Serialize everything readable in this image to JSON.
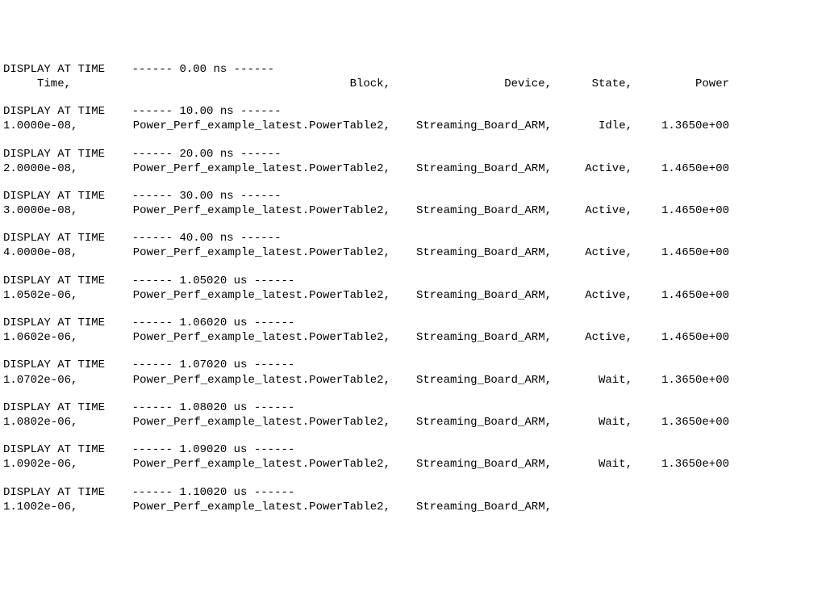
{
  "display_prefix": "DISPLAY AT TIME",
  "entries": [
    {
      "timestamp_header": "    ------ 0.00 ns ------",
      "time": "     Time,",
      "block": "Block,",
      "device": "Device,",
      "state": "State,",
      "power": "Power"
    },
    {
      "timestamp_header": "    ------ 10.00 ns ------",
      "time": "1.0000e-08,",
      "block": "Power_Perf_example_latest.PowerTable2,",
      "device": "Streaming_Board_ARM,",
      "state": "Idle,",
      "power": "1.3650e+00"
    },
    {
      "timestamp_header": "    ------ 20.00 ns ------",
      "time": "2.0000e-08,",
      "block": "Power_Perf_example_latest.PowerTable2,",
      "device": "Streaming_Board_ARM,",
      "state": "Active,",
      "power": "1.4650e+00"
    },
    {
      "timestamp_header": "    ------ 30.00 ns ------",
      "time": "3.0000e-08,",
      "block": "Power_Perf_example_latest.PowerTable2,",
      "device": "Streaming_Board_ARM,",
      "state": "Active,",
      "power": "1.4650e+00"
    },
    {
      "timestamp_header": "    ------ 40.00 ns ------",
      "time": "4.0000e-08,",
      "block": "Power_Perf_example_latest.PowerTable2,",
      "device": "Streaming_Board_ARM,",
      "state": "Active,",
      "power": "1.4650e+00"
    },
    {
      "timestamp_header": "    ------ 1.05020 us ------",
      "time": "1.0502e-06,",
      "block": "Power_Perf_example_latest.PowerTable2,",
      "device": "Streaming_Board_ARM,",
      "state": "Active,",
      "power": "1.4650e+00"
    },
    {
      "timestamp_header": "    ------ 1.06020 us ------",
      "time": "1.0602e-06,",
      "block": "Power_Perf_example_latest.PowerTable2,",
      "device": "Streaming_Board_ARM,",
      "state": "Active,",
      "power": "1.4650e+00"
    },
    {
      "timestamp_header": "    ------ 1.07020 us ------",
      "time": "1.0702e-06,",
      "block": "Power_Perf_example_latest.PowerTable2,",
      "device": "Streaming_Board_ARM,",
      "state": "Wait,",
      "power": "1.3650e+00"
    },
    {
      "timestamp_header": "    ------ 1.08020 us ------",
      "time": "1.0802e-06,",
      "block": "Power_Perf_example_latest.PowerTable2,",
      "device": "Streaming_Board_ARM,",
      "state": "Wait,",
      "power": "1.3650e+00"
    },
    {
      "timestamp_header": "    ------ 1.09020 us ------",
      "time": "1.0902e-06,",
      "block": "Power_Perf_example_latest.PowerTable2,",
      "device": "Streaming_Board_ARM,",
      "state": "Wait,",
      "power": "1.3650e+00"
    },
    {
      "timestamp_header": "    ------ 1.10020 us ------",
      "time": "1.1002e-06,",
      "block": "Power_Perf_example_latest.PowerTable2,",
      "device": "Streaming_Board_ARM,",
      "state": "",
      "power": ""
    }
  ]
}
